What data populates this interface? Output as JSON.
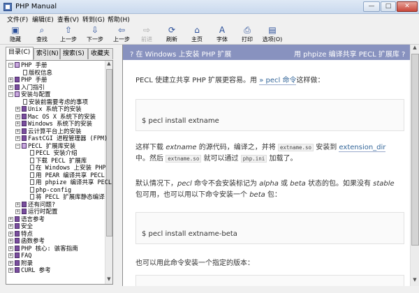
{
  "window": {
    "title": "PHP Manual",
    "minimize": "—",
    "maximize": "□",
    "close": "✕"
  },
  "menu": [
    "文件(F)",
    "编辑(E)",
    "查看(V)",
    "转到(G)",
    "帮助(H)"
  ],
  "toolbar": [
    {
      "label": "隐藏",
      "icon": "hide-icon",
      "glyph": "▣",
      "disabled": false
    },
    {
      "label": "查找",
      "icon": "find-icon",
      "glyph": "⌕",
      "disabled": false
    },
    {
      "label": "上一步",
      "icon": "up-arrow-icon",
      "glyph": "⇧",
      "disabled": false
    },
    {
      "label": "下一步",
      "icon": "down-arrow-icon",
      "glyph": "⇩",
      "disabled": false
    },
    {
      "label": "上一步",
      "icon": "back-arrow-icon",
      "glyph": "⇦",
      "disabled": false
    },
    {
      "label": "前进",
      "icon": "forward-arrow-icon",
      "glyph": "⇨",
      "disabled": true
    },
    {
      "label": "刷新",
      "icon": "refresh-icon",
      "glyph": "⟳",
      "disabled": false
    },
    {
      "label": "主页",
      "icon": "home-icon",
      "glyph": "⌂",
      "disabled": false
    },
    {
      "label": "字体",
      "icon": "font-icon",
      "glyph": "A",
      "disabled": false
    },
    {
      "label": "打印",
      "icon": "print-icon",
      "glyph": "⎙",
      "disabled": false
    },
    {
      "label": "选项(O)",
      "icon": "options-icon",
      "glyph": "▤",
      "disabled": false
    }
  ],
  "tabs": [
    "目录(C)",
    "索引(N)",
    "搜索(S)",
    "收藏夹"
  ],
  "tree": [
    {
      "label": "PHP 手册",
      "level": 0,
      "exp": "−",
      "kind": "book-open"
    },
    {
      "label": "版权信息",
      "level": 1,
      "exp": "",
      "kind": "page"
    },
    {
      "label": "PHP 手册",
      "level": 0,
      "exp": "+",
      "kind": "book"
    },
    {
      "label": "入门指引",
      "level": 0,
      "exp": "+",
      "kind": "book"
    },
    {
      "label": "安装与配置",
      "level": 0,
      "exp": "−",
      "kind": "book-open"
    },
    {
      "label": "安装前需要考虑的事项",
      "level": 1,
      "exp": "",
      "kind": "page"
    },
    {
      "label": "Unix 系统下的安装",
      "level": 1,
      "exp": "+",
      "kind": "book"
    },
    {
      "label": "Mac OS X 系统下的安装",
      "level": 1,
      "exp": "+",
      "kind": "book"
    },
    {
      "label": "Windows 系统下的安装",
      "level": 1,
      "exp": "+",
      "kind": "book"
    },
    {
      "label": "云计算平台上的安装",
      "level": 1,
      "exp": "+",
      "kind": "book"
    },
    {
      "label": "FastCGI 进程管理器 (FPM)",
      "level": 1,
      "exp": "+",
      "kind": "book"
    },
    {
      "label": "PECL 扩展库安装",
      "level": 1,
      "exp": "−",
      "kind": "book-open"
    },
    {
      "label": "PECL 安装介绍",
      "level": 2,
      "exp": "",
      "kind": "page"
    },
    {
      "label": "下载 PECL 扩展库",
      "level": 2,
      "exp": "",
      "kind": "page"
    },
    {
      "label": "在 Windows 上安装 PHP",
      "level": 2,
      "exp": "",
      "kind": "page"
    },
    {
      "label": "用 PEAR 编译共享 PECL",
      "level": 2,
      "exp": "",
      "kind": "page"
    },
    {
      "label": "用 phpize 编译共享 PECL",
      "level": 2,
      "exp": "",
      "kind": "page"
    },
    {
      "label": "php-config",
      "level": 2,
      "exp": "",
      "kind": "page"
    },
    {
      "label": "将 PECL 扩展库静态编译",
      "level": 2,
      "exp": "",
      "kind": "page"
    },
    {
      "label": "还有问题?",
      "level": 1,
      "exp": "+",
      "kind": "book"
    },
    {
      "label": "运行时配置",
      "level": 1,
      "exp": "+",
      "kind": "book"
    },
    {
      "label": "语言参考",
      "level": 0,
      "exp": "+",
      "kind": "book"
    },
    {
      "label": "安全",
      "level": 0,
      "exp": "+",
      "kind": "book"
    },
    {
      "label": "特点",
      "level": 0,
      "exp": "+",
      "kind": "book"
    },
    {
      "label": "函数参考",
      "level": 0,
      "exp": "+",
      "kind": "book"
    },
    {
      "label": "PHP 核心: 骇客指南",
      "level": 0,
      "exp": "+",
      "kind": "book"
    },
    {
      "label": "FAQ",
      "level": 0,
      "exp": "+",
      "kind": "book"
    },
    {
      "label": "附录",
      "level": 0,
      "exp": "+",
      "kind": "book"
    },
    {
      "label": "CURL 参考",
      "level": 0,
      "exp": "+",
      "kind": "book"
    }
  ],
  "content": {
    "prev": "? 在 Windows 上安装 PHP 扩展",
    "next": "用 phpize 编译共享 PECL 扩展库 ?",
    "p1_a": "PECL 使建立共享 PHP 扩展更容易。用 ",
    "p1_link": "» pecl 命令",
    "p1_b": "这样做：",
    "code1": "$ pecl install extname",
    "p2_a": "这样下载 ",
    "p2_em": "extname",
    "p2_b": " 的源代码，编译之，并将 ",
    "p2_code1": "extname.so",
    "p2_c": " 安装到 ",
    "p2_link": "extension_dir",
    "p2_d": " 中。然后 ",
    "p2_code2": "extname.so",
    "p2_e": " 就可以通过 ",
    "p2_code3": "php.ini",
    "p2_f": " 加载了。",
    "p3_a": "默认情况下，",
    "p3_em1": "pecl",
    "p3_b": " 命令不会安装标记为 ",
    "p3_em2": "alpha",
    "p3_c": " 或 ",
    "p3_em3": "beta",
    "p3_d": " 状态的包。如果没有 ",
    "p3_em4": "stable",
    "p3_e": " 包可用，也可以用以下命令安装一个 ",
    "p3_em5": "beta",
    "p3_f": " 包：",
    "code2": "$ pecl install extname-beta",
    "p4": "也可以用此命令安装一个指定的版本："
  }
}
